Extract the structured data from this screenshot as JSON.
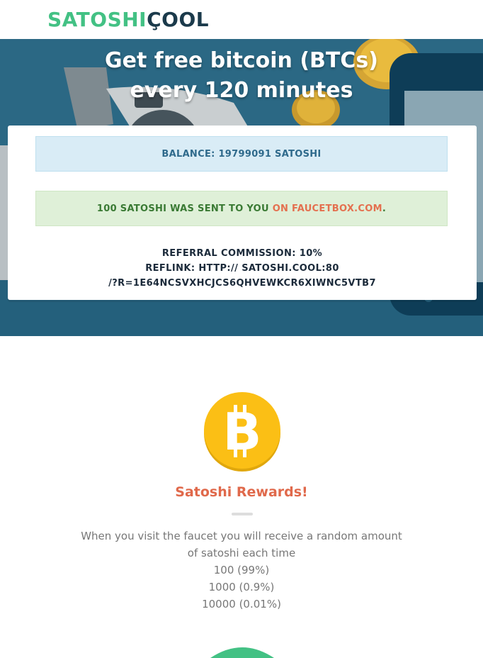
{
  "logo": {
    "part1": "SATOSHI",
    "part2": "ÇOOL"
  },
  "hero": {
    "line1": "Get free bitcoin (BTCs)",
    "line2": "every 120 minutes"
  },
  "balance": {
    "text": "BALANCE: 19799091 SATOSHI"
  },
  "payment": {
    "message": "100 SATOSHI WAS SENT TO YOU ",
    "link_text": "ON FAUCETBOX.COM",
    "suffix": "."
  },
  "referral": {
    "commission": "REFERRAL COMMISSION: 10%",
    "reflink_line1": "REFLINK: HTTP:// SATOSHI.COOL:80",
    "reflink_line2": "/?R=1E64NCSVXHCJCS6QHVEWKCR6XIWNC5VTB7"
  },
  "rewards": {
    "title": "Satoshi Rewards!",
    "description": "When you visit the faucet you will receive a random amount of satoshi each time",
    "tiers": [
      "100 (99%)",
      "1000 (0.9%)",
      "10000 (0.01%)"
    ]
  },
  "colors": {
    "brand_green": "#43c184",
    "brand_dark": "#1b3a4b",
    "accent_orange": "#e0694b",
    "coin_gold": "#fbbf15",
    "hero_blue": "#2a6683"
  },
  "icons": {
    "coin": "bitcoin-icon"
  }
}
